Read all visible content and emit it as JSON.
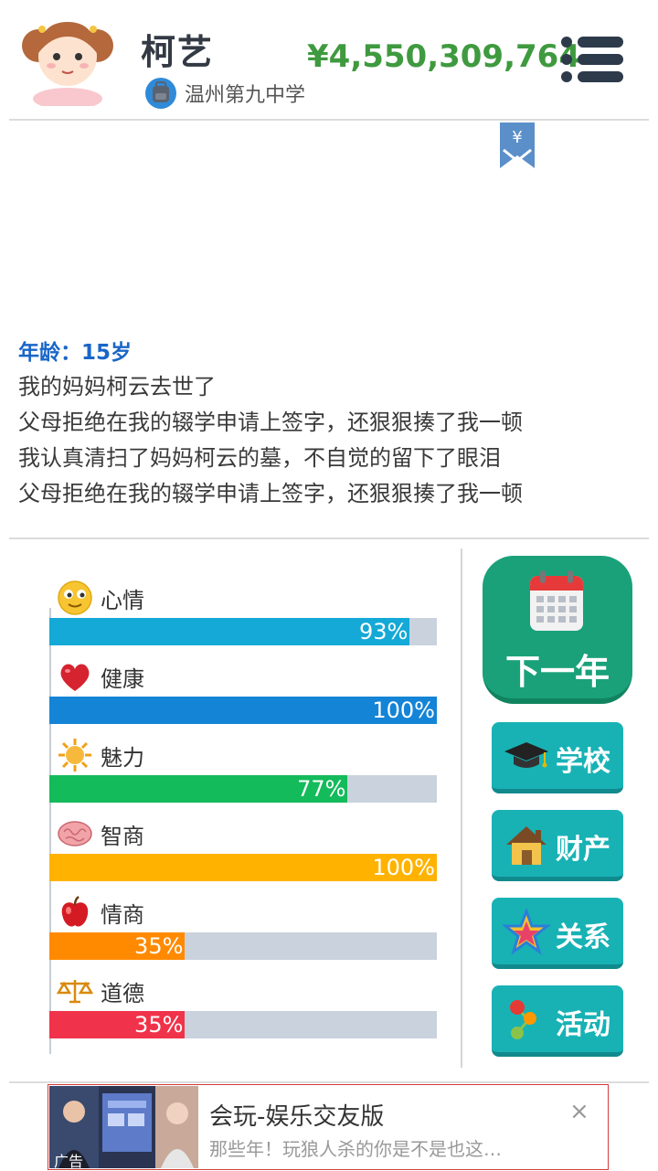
{
  "profile": {
    "name": "柯艺",
    "school": "温州第九中学",
    "money": "¥4,550,309,764"
  },
  "log": {
    "age_label": "年龄：15岁",
    "lines": [
      "我的妈妈柯云去世了",
      "父母拒绝在我的辍学申请上签字，还狠狠揍了我一顿",
      "我认真清扫了妈妈柯云的墓，不自觉的留下了眼泪",
      "父母拒绝在我的辍学申请上签字，还狠狠揍了我一顿"
    ]
  },
  "stats": [
    {
      "label": "心情",
      "value": 93,
      "pct": "93%",
      "color": "#14a9d6",
      "icon": "smiley-icon"
    },
    {
      "label": "健康",
      "value": 100,
      "pct": "100%",
      "color": "#1484d6",
      "icon": "heart-icon"
    },
    {
      "label": "魅力",
      "value": 77,
      "pct": "77%",
      "color": "#13bb5a",
      "icon": "sun-icon"
    },
    {
      "label": "智商",
      "value": 100,
      "pct": "100%",
      "color": "#ffb300",
      "icon": "brain-icon"
    },
    {
      "label": "情商",
      "value": 35,
      "pct": "35%",
      "color": "#ff8a00",
      "icon": "apple-icon"
    },
    {
      "label": "道德",
      "value": 35,
      "pct": "35%",
      "color": "#f0334a",
      "icon": "scales-icon"
    }
  ],
  "actions": {
    "next_year": "下一年",
    "school": "学校",
    "property": "财产",
    "relations": "关系",
    "activities": "活动"
  },
  "ad": {
    "title": "会玩-娱乐交友版",
    "description": "那些年！玩狼人杀的你是不是也这…",
    "tag": "广告",
    "close": "×"
  },
  "colors": {
    "money": "#3f9a3f",
    "age": "#1a66c8",
    "next_year_bg": "#1aa17a",
    "side_button_bg": "#18b2b5"
  }
}
